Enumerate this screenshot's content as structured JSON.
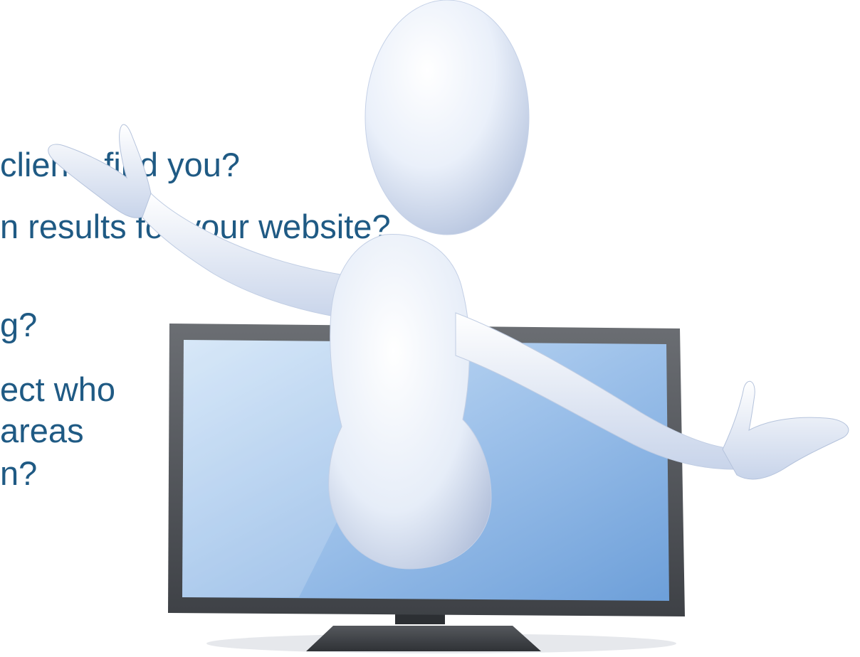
{
  "slide": {
    "lines": [
      "clients find you?",
      "n results for your website?",
      "g?",
      "ect who",
      "areas",
      "n?"
    ]
  },
  "illustration": {
    "subject": "3d-figure-emerging-from-monitor",
    "colors": {
      "figure": "#e8eef8",
      "figure_shade": "#b9c6e0",
      "screen": "#8fb6e6",
      "screen_light": "#cfe3f7",
      "bezel": "#4a4d52",
      "stand": "#3b3e43"
    }
  }
}
